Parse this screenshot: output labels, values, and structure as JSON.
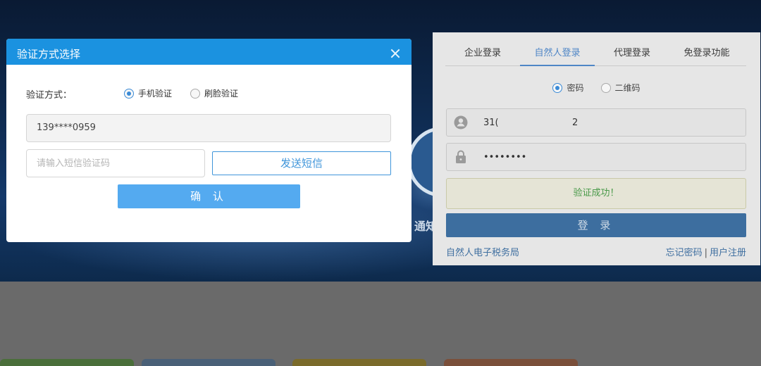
{
  "background": {
    "hero_text": "通知"
  },
  "login_panel": {
    "tabs": [
      {
        "label": "企业登录",
        "active": false
      },
      {
        "label": "自然人登录",
        "active": true
      },
      {
        "label": "代理登录",
        "active": false
      },
      {
        "label": "免登录功能",
        "active": false
      }
    ],
    "login_type": {
      "options": [
        "密码",
        "二维码"
      ],
      "selected": "密码"
    },
    "username_value": "31(",
    "username_value_tail": "2",
    "password_value": "••••••••",
    "status_message": "验证成功！",
    "login_button": "登 录",
    "link_left": "自然人电子税务局",
    "link_forgot": "忘记密码",
    "link_separator": "|",
    "link_register": "用户注册"
  },
  "modal": {
    "title": "验证方式选择",
    "method_label": "验证方式：",
    "methods": [
      "手机验证",
      "刷脸验证"
    ],
    "selected_method": "手机验证",
    "phone_value": "139****0959",
    "code_placeholder": "请输入短信验证码",
    "send_sms_button": "发送短信",
    "confirm_button": "确 认"
  },
  "colors": {
    "modal_header": "#1b92e0",
    "confirm_button": "#54aaf0",
    "send_button_border": "#3f95da",
    "active_tab": "#4f86c6",
    "success_text": "#4a9a4a"
  }
}
